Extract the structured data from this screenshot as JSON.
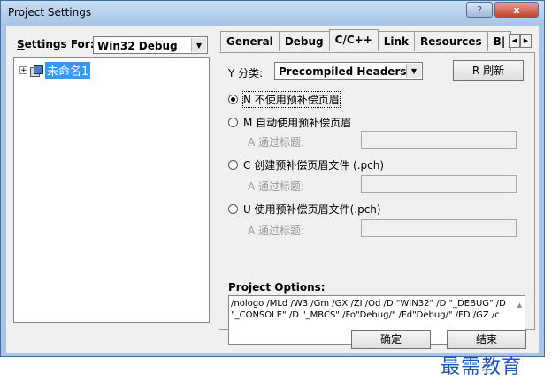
{
  "window": {
    "title": "Project Settings",
    "help_label": "?",
    "close_label": "x"
  },
  "left": {
    "settings_label_hotkey": "S",
    "settings_label_rest": "ettings For:",
    "settings_value": "Win32 Debug",
    "tree_item": "未命名1"
  },
  "tabs": [
    "General",
    "Debug",
    "C/C++",
    "Link",
    "Resources",
    "B|"
  ],
  "category": {
    "label": "Y 分类:",
    "value": "Precompiled Headers",
    "refresh_label": "R 刷新"
  },
  "options": [
    {
      "label": "N 不使用预补偿页眉",
      "checked": true
    },
    {
      "label": "M 自动使用预补偿页眉",
      "checked": false,
      "sub": "A 通过标题:"
    },
    {
      "label": "C 创建预补偿页眉文件 (.pch)",
      "checked": false,
      "sub": "A 通过标题:"
    },
    {
      "label": "U 使用预补偿页眉文件(.pch)",
      "checked": false,
      "sub": "A 通过标题:"
    }
  ],
  "project_options": {
    "label": "Project Options:",
    "text": "/nologo /MLd /W3 /Gm /GX /ZI /Od /D \"WIN32\" /D \"_DEBUG\" /D \"_CONSOLE\" /D \"_MBCS\" /Fo\"Debug/\" /Fd\"Debug/\" /FD /GZ /c"
  },
  "buttons": {
    "ok": "确定",
    "end": "结束"
  },
  "watermark": "最需教育"
}
